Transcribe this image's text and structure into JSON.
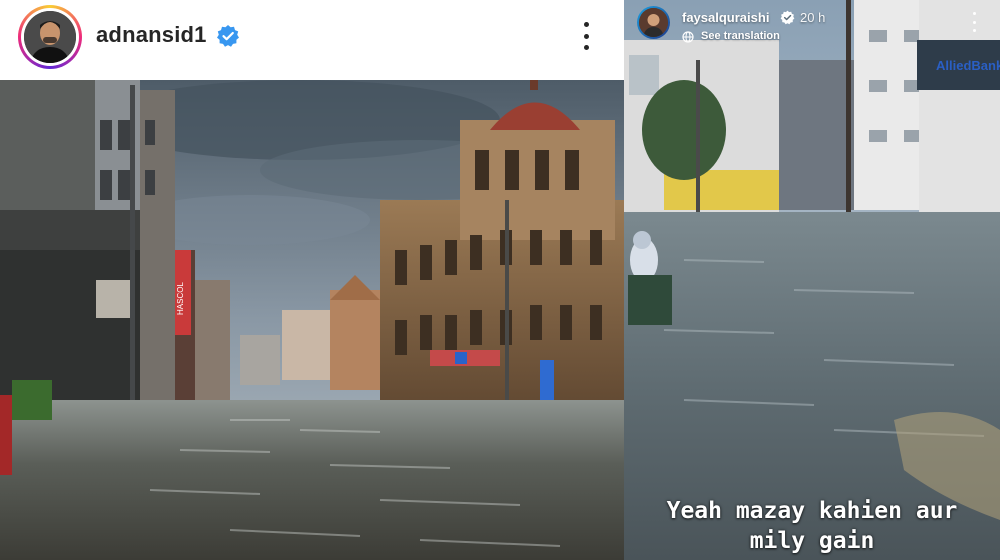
{
  "post": {
    "username": "adnansid1",
    "verified_icon": "verified-badge-icon",
    "more_icon": "more-vertical-icon",
    "image": {
      "scene": "flooded street with colonial-era domed building under overcast sky",
      "sign_text": "HASCOL"
    }
  },
  "story": {
    "username": "faysalquraishi",
    "time": "20 h",
    "see_translation": "See translation",
    "globe_icon": "globe-icon",
    "more_icon": "more-vertical-icon",
    "caption_line1": "Yeah mazay kahien aur",
    "caption_line2": "mily gain",
    "sign_text": "AlliedBank"
  },
  "colors": {
    "verified_blue": "#3897f0",
    "text_dark": "#262626",
    "sky": "#8796a3",
    "water": "#6f7a7e"
  }
}
